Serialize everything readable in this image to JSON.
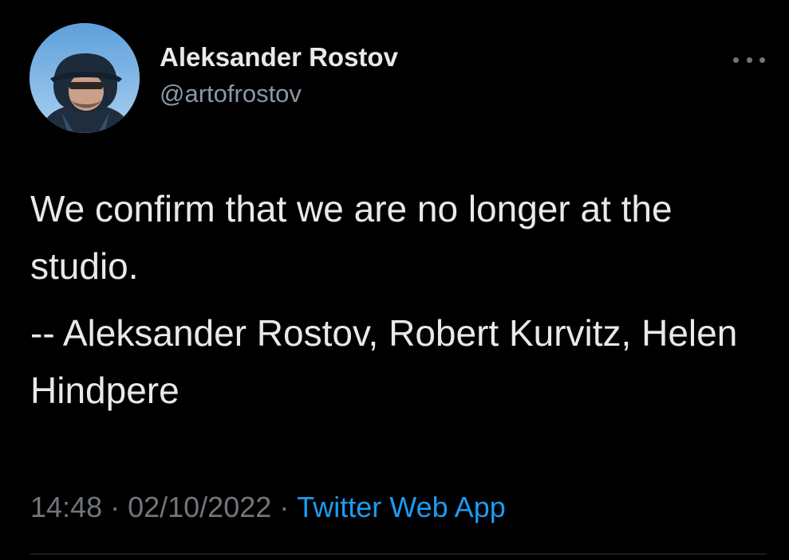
{
  "author": {
    "display_name": "Aleksander Rostov",
    "handle": "@artofrostov"
  },
  "tweet": {
    "paragraphs": [
      "We confirm that we are no longer at the studio.",
      "-- Aleksander Rostov, Robert Kurvitz, Helen Hindpere"
    ]
  },
  "meta": {
    "time": "14:48",
    "separator": "·",
    "date": "02/10/2022",
    "source": "Twitter Web App"
  },
  "icons": {
    "more": "more-horizontal-icon",
    "avatar": "profile-photo"
  },
  "colors": {
    "background": "#000000",
    "primary_text": "#e7e9ea",
    "secondary_text": "#71767b",
    "link": "#1d9bf0"
  }
}
